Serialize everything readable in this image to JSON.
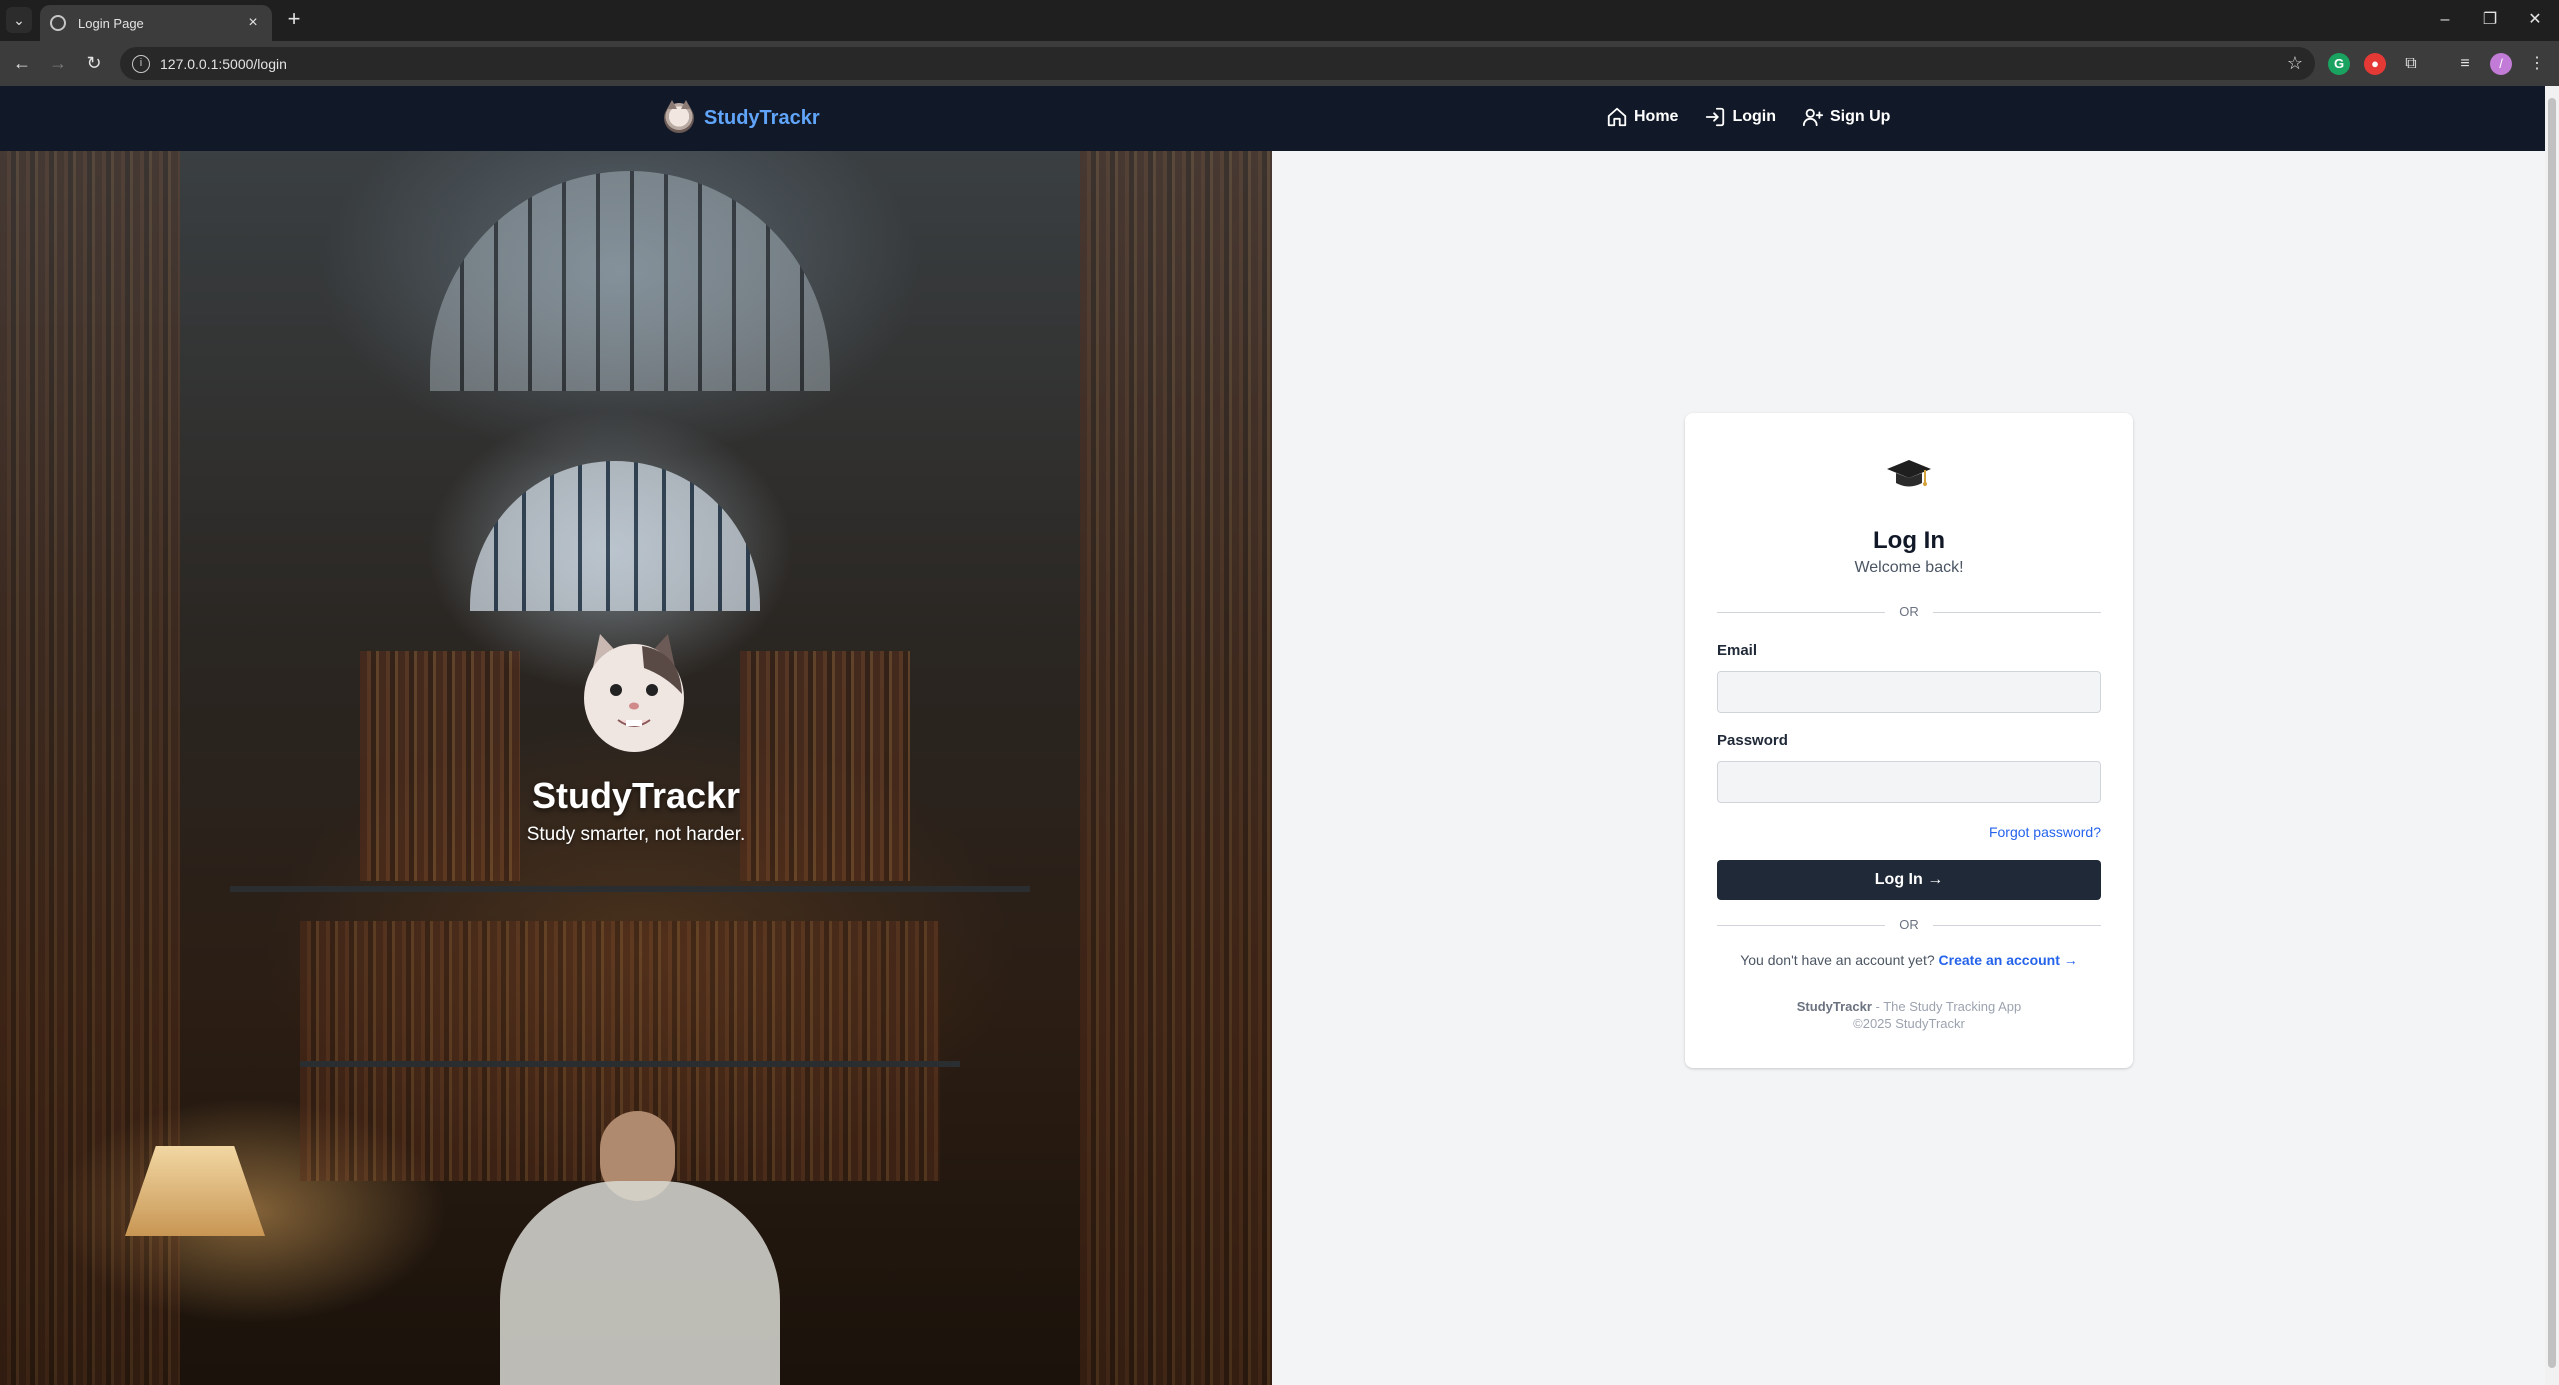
{
  "browser": {
    "tab_title": "Login Page",
    "url": "127.0.0.1:5000/login"
  },
  "nav": {
    "brand": "StudyTrackr",
    "links": [
      {
        "label": "Home",
        "icon": "home-icon"
      },
      {
        "label": "Login",
        "icon": "login-icon"
      },
      {
        "label": "Sign Up",
        "icon": "user-plus-icon"
      }
    ]
  },
  "hero": {
    "title": "StudyTrackr",
    "subtitle": "Study smarter, not harder."
  },
  "login": {
    "icon": "graduation-cap-icon",
    "title": "Log In",
    "subtitle": "Welcome back!",
    "divider_top": "OR",
    "email_label": "Email",
    "email_value": "",
    "password_label": "Password",
    "password_value": "",
    "forgot": "Forgot password?",
    "submit": "Log In →",
    "divider_bottom": "OR",
    "no_account": "You don't have an account yet?",
    "create_account": "Create an account →",
    "footer_brand": "StudyTrackr",
    "footer_tagline": " - The Study Tracking App",
    "copyright": "©2025 StudyTrackr"
  },
  "colors": {
    "nav_bg": "#111827",
    "brand_blue": "#60a5fa",
    "button_dark": "#1f2937",
    "link_blue": "#2563eb"
  }
}
